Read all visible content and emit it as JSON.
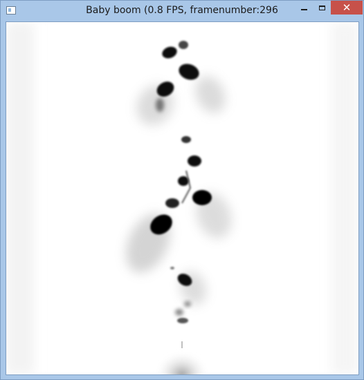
{
  "window": {
    "title": "Baby boom (0.8 FPS, framenumber:296",
    "icon": "app-window-icon",
    "controls": {
      "minimize_icon": "minimize-icon",
      "maximize_icon": "maximize-icon",
      "close_icon": "close-icon",
      "close_glyph": "✕"
    },
    "colors": {
      "titlebar": "#a9c7e8",
      "close_button": "#c7514a",
      "client_background": "#ffffff"
    }
  },
  "simulation": {
    "fps": 0.8,
    "frame_number": 296,
    "render": "grayscale density field (dark blobs on white)"
  }
}
